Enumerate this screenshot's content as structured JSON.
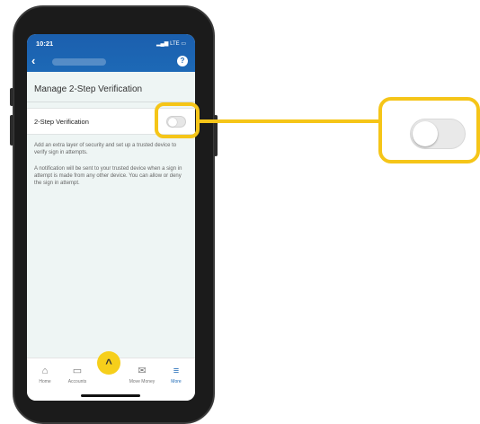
{
  "statusbar": {
    "time": "10:21",
    "network": "LTE"
  },
  "header": {
    "back_icon": "chevron-left-icon",
    "help_icon": "help-bubble-icon",
    "brand_color": "#1d69b6"
  },
  "page": {
    "title": "Manage 2-Step Verification",
    "setting_label": "2-Step Verification",
    "setting_enabled": false,
    "desc1": "Add an extra layer of security and set up a trusted device to verify sign in attempts.",
    "desc2": "A notification will be sent to your trusted device when a sign in attempt is made from any other device. You can allow or deny the sign in attempt."
  },
  "nav": {
    "home": "Home",
    "accounts": "Accounts",
    "move_money": "Move Money",
    "more": "More",
    "active": "More"
  },
  "highlight_color": "#f5c518"
}
